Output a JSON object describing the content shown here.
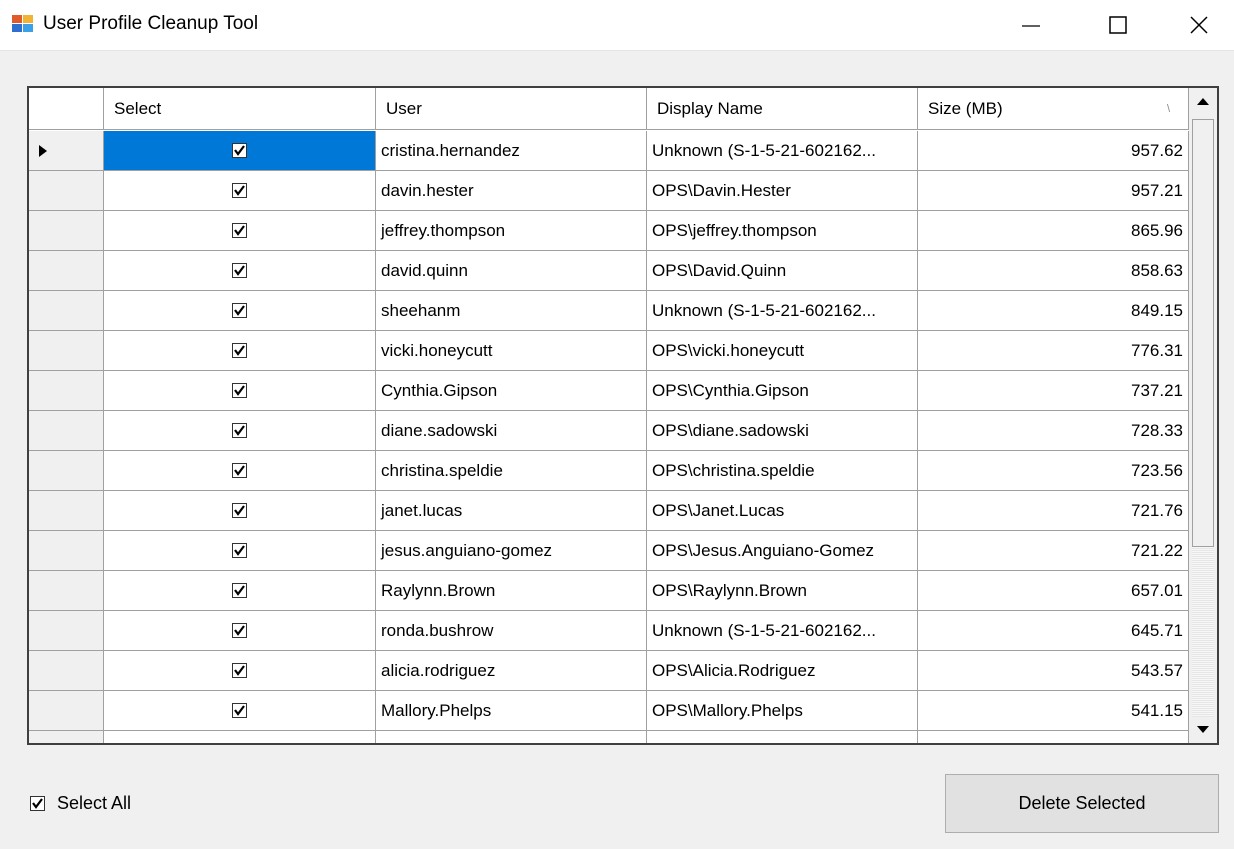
{
  "window": {
    "title": "User Profile Cleanup Tool"
  },
  "grid": {
    "columns": {
      "select": "Select",
      "user": "User",
      "display_name": "Display Name",
      "size": "Size (MB)"
    },
    "sort_indicator": "\\",
    "rows": [
      {
        "checked": true,
        "user": "cristina.hernandez",
        "display_name": "Unknown (S-1-5-21-602162...",
        "size": "957.62"
      },
      {
        "checked": true,
        "user": "davin.hester",
        "display_name": "OPS\\Davin.Hester",
        "size": "957.21"
      },
      {
        "checked": true,
        "user": "jeffrey.thompson",
        "display_name": "OPS\\jeffrey.thompson",
        "size": "865.96"
      },
      {
        "checked": true,
        "user": "david.quinn",
        "display_name": "OPS\\David.Quinn",
        "size": "858.63"
      },
      {
        "checked": true,
        "user": "sheehanm",
        "display_name": "Unknown (S-1-5-21-602162...",
        "size": "849.15"
      },
      {
        "checked": true,
        "user": "vicki.honeycutt",
        "display_name": "OPS\\vicki.honeycutt",
        "size": "776.31"
      },
      {
        "checked": true,
        "user": "Cynthia.Gipson",
        "display_name": "OPS\\Cynthia.Gipson",
        "size": "737.21"
      },
      {
        "checked": true,
        "user": "diane.sadowski",
        "display_name": "OPS\\diane.sadowski",
        "size": "728.33"
      },
      {
        "checked": true,
        "user": "christina.speldie",
        "display_name": "OPS\\christina.speldie",
        "size": "723.56"
      },
      {
        "checked": true,
        "user": "janet.lucas",
        "display_name": "OPS\\Janet.Lucas",
        "size": "721.76"
      },
      {
        "checked": true,
        "user": "jesus.anguiano-gomez",
        "display_name": "OPS\\Jesus.Anguiano-Gomez",
        "size": "721.22"
      },
      {
        "checked": true,
        "user": "Raylynn.Brown",
        "display_name": "OPS\\Raylynn.Brown",
        "size": "657.01"
      },
      {
        "checked": true,
        "user": "ronda.bushrow",
        "display_name": "Unknown (S-1-5-21-602162...",
        "size": "645.71"
      },
      {
        "checked": true,
        "user": "alicia.rodriguez",
        "display_name": "OPS\\Alicia.Rodriguez",
        "size": "543.57"
      },
      {
        "checked": true,
        "user": "Mallory.Phelps",
        "display_name": "OPS\\Mallory.Phelps",
        "size": "541.15"
      },
      {
        "checked": true,
        "user": "",
        "display_name": "",
        "size": ""
      }
    ]
  },
  "footer": {
    "select_all_label": "Select All",
    "select_all_checked": true,
    "delete_label": "Delete Selected"
  },
  "colors": {
    "selection": "#0078d7"
  },
  "icons": {
    "app": "app-icon",
    "minimize": "minimize-icon",
    "maximize": "maximize-icon",
    "close": "close-icon",
    "row_pointer": "row-pointer-icon",
    "scroll_up": "scroll-up-arrow-icon",
    "scroll_down": "scroll-down-arrow-icon"
  }
}
